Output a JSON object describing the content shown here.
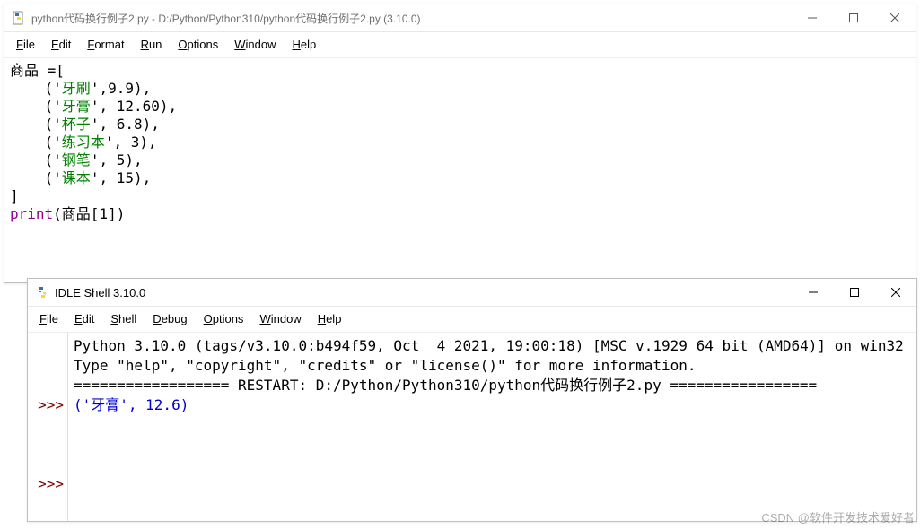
{
  "editor": {
    "title": "python代码换行例子2.py - D:/Python/Python310/python代码换行例子2.py (3.10.0)",
    "menu": [
      "File",
      "Edit",
      "Format",
      "Run",
      "Options",
      "Window",
      "Help"
    ],
    "code": {
      "l1a": "商品 =[",
      "l2a": "    ('",
      "l2b": "牙刷",
      "l2c": "',9.9),",
      "l3a": "    ('",
      "l3b": "牙膏",
      "l3c": "', 12.60),",
      "l4a": "    ('",
      "l4b": "杯子",
      "l4c": "', 6.8),",
      "l5a": "    ('",
      "l5b": "练习本",
      "l5c": "', 3),",
      "l6a": "    ('",
      "l6b": "钢笔",
      "l6c": "', 5),",
      "l7a": "    ('",
      "l7b": "课本",
      "l7c": "', 15),",
      "l8": "]",
      "l9a": "print",
      "l9b": "(商品[1])"
    }
  },
  "shell": {
    "title": "IDLE Shell 3.10.0",
    "menu": [
      "File",
      "Edit",
      "Shell",
      "Debug",
      "Options",
      "Window",
      "Help"
    ],
    "prompt": ">>>",
    "out": {
      "banner1": "Python 3.10.0 (tags/v3.10.0:b494f59, Oct  4 2021, 19:00:18) [MSC v.1929 64 bit (AMD64)] on win32",
      "banner2": "Type \"help\", \"copyright\", \"credits\" or \"license()\" for more information.",
      "restart": "================== RESTART: D:/Python/Python310/python代码换行例子2.py =================",
      "result": "('牙膏', 12.6)"
    }
  },
  "watermark": "CSDN @软件开发技术爱好者"
}
